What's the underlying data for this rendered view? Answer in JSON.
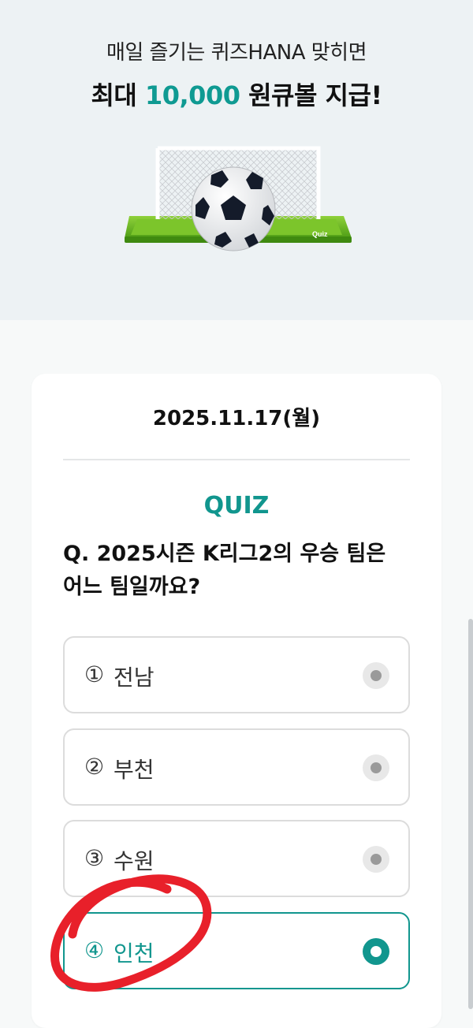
{
  "hero": {
    "line1": "매일 즐기는 퀴즈HANA 맞히면",
    "line2_prefix": "최대 ",
    "line2_amount": "10,000",
    "line2_suffix": " 원큐볼 지급!",
    "illustration_badge": "Quiz"
  },
  "quiz": {
    "date": "2025.11.17(월)",
    "label": "QUIZ",
    "question": "Q. 2025시즌 K리그2의 우승 팀은 어느 팀일까요?",
    "options": [
      {
        "num": "①",
        "label": "전남",
        "selected": false
      },
      {
        "num": "②",
        "label": "부천",
        "selected": false
      },
      {
        "num": "③",
        "label": "수원",
        "selected": false
      },
      {
        "num": "④",
        "label": "인천",
        "selected": true
      }
    ]
  },
  "colors": {
    "accent": "#11968e",
    "hero_bg": "#edf2f4",
    "annotation": "#e8202a"
  },
  "icons": {
    "illustration": "soccer-goal-ball-icon",
    "radio": "radio-button-icon"
  }
}
